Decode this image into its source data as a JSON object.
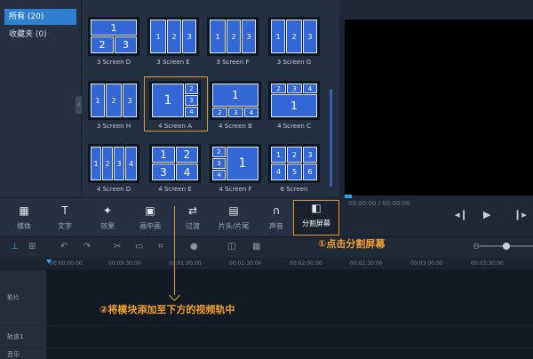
{
  "categories": [
    {
      "label": "所有 (20)",
      "selected": true
    },
    {
      "label": "收藏夹 (0)",
      "selected": false
    }
  ],
  "templates": [
    {
      "label": "3 Screen D"
    },
    {
      "label": "3 Screen E"
    },
    {
      "label": "3 Screen F"
    },
    {
      "label": "3 Screen G"
    },
    {
      "label": "3 Screen H"
    },
    {
      "label": "4 Screen A"
    },
    {
      "label": "4 Screen B"
    },
    {
      "label": "4 Screen C"
    },
    {
      "label": "4 Screen D"
    },
    {
      "label": "4 Screen E"
    },
    {
      "label": "4 Screen F"
    },
    {
      "label": "6 Screen"
    }
  ],
  "toolbar": [
    {
      "label": "媒体",
      "icon": "film-icon"
    },
    {
      "label": "文字",
      "icon": "text-icon"
    },
    {
      "label": "效果",
      "icon": "wand-icon"
    },
    {
      "label": "画中画",
      "icon": "pip-icon"
    },
    {
      "label": "过渡",
      "icon": "transition-icon"
    },
    {
      "label": "片头/片尾",
      "icon": "clapper-icon"
    },
    {
      "label": "声音",
      "icon": "headphones-icon"
    },
    {
      "label": "分割屏幕",
      "icon": "split-screen-icon",
      "active": true
    }
  ],
  "playback": {
    "timecode": "00:00:00 / 00:00:00"
  },
  "ruler": [
    "00:00:00:00",
    "00:00:30:00",
    "00:01:00:00",
    "00:01:30:00",
    "00:02:00:00",
    "00:02:30:00",
    "00:03:00:00",
    "00:03:30:00"
  ],
  "tracks": [
    {
      "label": "影片"
    },
    {
      "label": "轨道1"
    },
    {
      "label": "音乐"
    }
  ],
  "annotations": {
    "step1": "①点击分割屏幕",
    "step2": "②将模块添加至下方的视频轨中"
  },
  "colors": {
    "accent": "#e09a2c",
    "cell": "#3467d6",
    "selected": "#2f7fd1"
  }
}
